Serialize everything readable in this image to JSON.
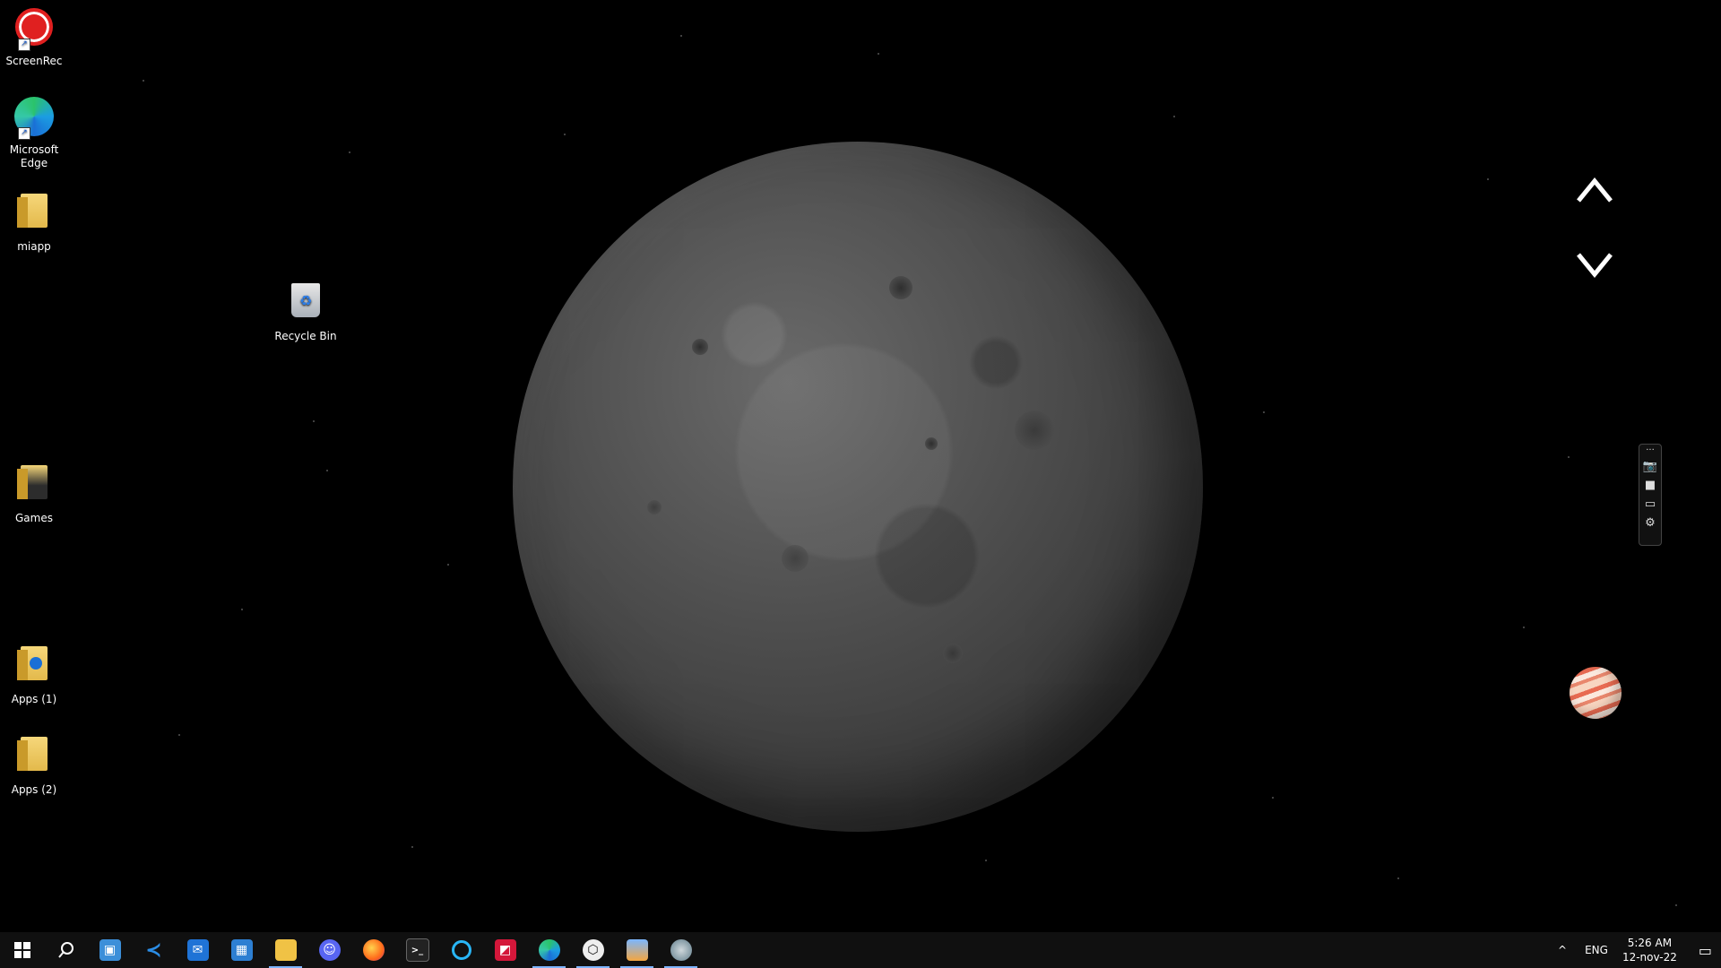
{
  "desktop_icons": [
    {
      "id": "screenrec",
      "label": "ScreenRec",
      "icon": "screenrec-icon"
    },
    {
      "id": "edge",
      "label": "Microsoft Edge",
      "icon": "edge-icon"
    },
    {
      "id": "miapp",
      "label": "miapp",
      "icon": "folder-icon"
    },
    {
      "id": "recycle",
      "label": "Recycle Bin",
      "icon": "recycle-bin-icon"
    },
    {
      "id": "games",
      "label": "Games",
      "icon": "folder-icon"
    },
    {
      "id": "apps1",
      "label": "Apps (1)",
      "icon": "folder-icon"
    },
    {
      "id": "apps2",
      "label": "Apps (2)",
      "icon": "folder-icon"
    }
  ],
  "widget": {
    "up_icon": "chevron-up-icon",
    "down_icon": "chevron-down-icon",
    "planet_icon": "jupiter-icon"
  },
  "capture_toolbar": [
    "more-icon",
    "camera-icon",
    "video-icon",
    "window-icon",
    "gear-icon"
  ],
  "taskbar": {
    "apps": [
      "start-icon",
      "search-icon",
      "task-view-icon",
      "vscode-icon",
      "mail-icon",
      "store-icon",
      "file-explorer-icon",
      "discord-icon",
      "firefox-icon",
      "terminal-icon",
      "cortana-icon",
      "amd-icon",
      "edge-icon",
      "unity-icon",
      "photos-icon",
      "app-icon"
    ],
    "tray": {
      "language": "ENG",
      "time": "5:26 AM",
      "date": "12-nov-22"
    }
  }
}
